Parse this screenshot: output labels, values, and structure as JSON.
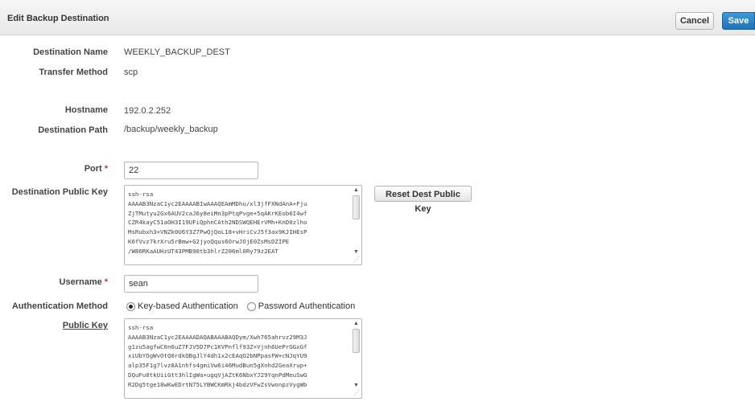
{
  "header": {
    "title": "Edit Backup Destination",
    "cancel_label": "Cancel",
    "save_label": "Save"
  },
  "fields": {
    "destination_name": {
      "label": "Destination Name",
      "value": "WEEKLY_BACKUP_DEST"
    },
    "transfer_method": {
      "label": "Transfer Method",
      "value": "scp"
    },
    "hostname": {
      "label": "Hostname",
      "value": "192.0.2.252"
    },
    "destination_path": {
      "label": "Destination Path",
      "value": "/backup/weekly_backup"
    },
    "port": {
      "label": "Port",
      "required_mark": "*",
      "value": "22"
    },
    "dest_public_key": {
      "label": "Destination Public Key",
      "lines": [
        "ssh-rsa",
        "AAAAB3NzaC1yc2EAAAABIwAAAQEAmMDhu/xl3jfFXNdAnA+Fju",
        "ZjTMutyu2Gx6AUV2caJ6y8eiMn3pPtqPvge+5qAKrKEob6I4wf",
        "CZR4kayC51aOH3I19UFiQphnCAth2NDSWQEHErVMh+KnD0zlho",
        "MsRubxh3+VNZk0U6Y3Z7PwQjQoL18+vHriCvJ5f3ax9KJIHEsP",
        "K6fVvz7krXru5rBmw+G2jyoQqus6OrwJOjE0ZsMsDZIPE",
        "/W86RKaAUHzUT43PMB90tb3hlrZ206ml0Ry79z2EAT"
      ],
      "reset_label": "Reset Dest Public Key"
    },
    "username": {
      "label": "Username",
      "required_mark": "*",
      "value": "sean"
    },
    "auth_method": {
      "label": "Authentication Method",
      "options": [
        "Key-based Authentication",
        "Password Authentication"
      ],
      "selected": "Key-based Authentication"
    },
    "public_key": {
      "label": "Public Key",
      "lines": [
        "ssh-rsa",
        "AAAAB3NzaC1yc2EAAAADAQABAAABAQDym/Xwh765ahrvz29M3J",
        "g1zu5agfwC0n6uZ7FJV5D7Pc1KVPnflf93Z+Vjnh6UePrGGxGf",
        "xiUbYOgWvOtQ0rdkQBgJlY4dh1x2cEAqO2bNPpasFW+cNJqYU9",
        "alp35F1g7lvz8A1nhfs4gmiVw6i46MudBun5gXnhd2GeaXrup+",
        "DQuFu0tkUiiGtt3hlIgWa+ugqVjAZtK6NbxYJ29YqnPdMeuSwG",
        "R2Dg5tge18wKwEDrtN75LYBWCKmRkj4bdzVFwZsVwonpzVygWb"
      ]
    }
  }
}
